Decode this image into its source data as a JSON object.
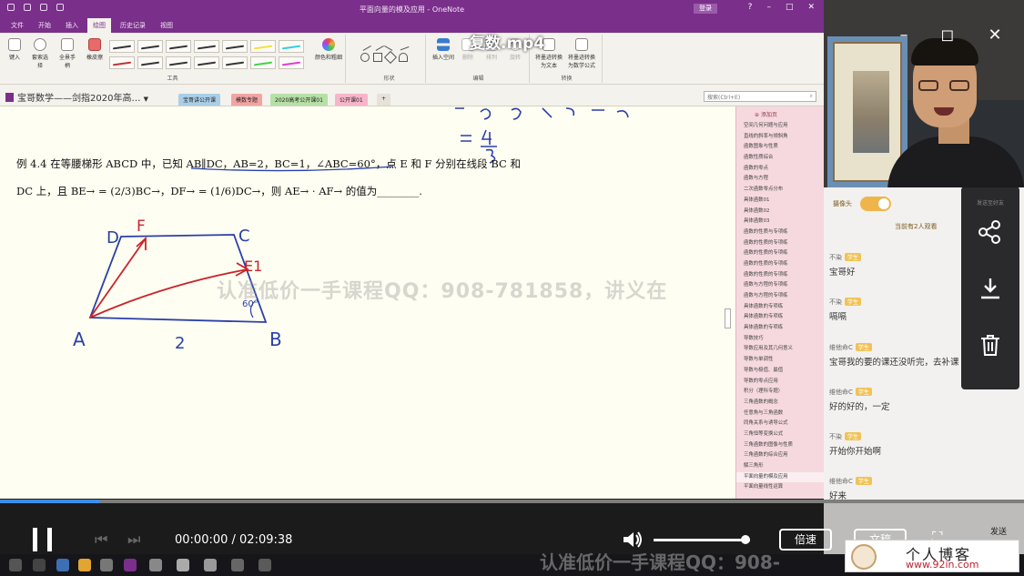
{
  "onenote": {
    "window_title": "平面向量的模及应用 - OneNote",
    "signin": "登录",
    "window_controls": [
      "?",
      "–",
      "□",
      "✕"
    ],
    "tabs": [
      "文件",
      "开始",
      "插入",
      "绘图",
      "历史记录",
      "视图"
    ],
    "active_tab": "绘图",
    "tools_group_label": "工具",
    "tools": [
      "键入",
      "套索选择",
      "全景手柄",
      "橡皮擦"
    ],
    "colors_label": "颜色和粗细",
    "shapes_label": "形状",
    "edit_label": "编辑",
    "convert_label": "转换",
    "edit_tools": [
      "插入空间",
      "删除",
      "排列",
      "旋转"
    ],
    "convert_tools": [
      "将墨迹转换为文本",
      "将墨迹转换为数学公式"
    ],
    "notebook_name": "宝哥数学——剑指2020年高…",
    "section_tabs": [
      {
        "label": "宝哥讲公开课",
        "color": "#a9cfe8"
      },
      {
        "label": "模数专题",
        "color": "#f3a3a3"
      },
      {
        "label": "2020高考公开课01",
        "color": "#b6e0a6"
      },
      {
        "label": "公开课01",
        "color": "#f7b5cb"
      }
    ],
    "add_tab": "+",
    "search_placeholder": "搜索(Ctrl+E)",
    "add_page": "添加页",
    "pages": [
      "空间几何问题与应用",
      "直线的斜率与倾斜角",
      "函数图象与性质",
      "函数性质综合",
      "函数的零点",
      "函数与方程",
      "二次函数零点分布",
      "具体函数01",
      "具体函数02",
      "具体函数03",
      "函数的性质与专项练",
      "函数的性质的专项练",
      "函数的性质的专项练",
      "函数的性质的专项练",
      "函数的性质的专项练",
      "函数与方程的专项练",
      "函数与方程的专项练",
      "具体函数的专项练",
      "具体函数的专项练",
      "具体函数的专项练",
      "导数技巧",
      "导数应用及其几何意义",
      "导数与单调性",
      "导数与极值、最值",
      "导数的零点应用",
      "积分（理科专题）",
      "三角函数的概念",
      "任意角与三角函数",
      "同角关系与诱导公式",
      "三角恒等变换公式",
      "三角函数的图像与性质",
      "三角函数的综合应用",
      "解三角形",
      "平面向量的模及应用",
      "平面向量线性运算"
    ]
  },
  "problem": {
    "line1": "例 4.4 在等腰梯形 ABCD 中，已知 AB∥DC，AB=2，BC=1，∠ABC=60°，点 E 和 F 分别在线段 BC 和",
    "line2": "DC 上，且 BE→ = (2/3)BC→，DF→ = (1/6)DC→，则 AE→ · AF→ 的值为________.",
    "handwriting_top": "= 4/3",
    "labels": {
      "D": "D",
      "F": "F",
      "C": "C",
      "E": "E1",
      "A": "A",
      "B": "B",
      "base": "2",
      "angle": "60°"
    }
  },
  "video": {
    "title": "复数.mp4",
    "time_current": "00:00:00",
    "time_total": "02:09:38",
    "time_display": "00:00:00 / 02:09:38",
    "progress_fraction": 0.097,
    "volume_fraction": 0.95,
    "speed_button": "倍速",
    "text_button": "文稿",
    "send_button": "发送"
  },
  "live": {
    "camera_label": "摄像头",
    "camera_on": true,
    "viewers": "当前有2人观看",
    "share_title": "发送至好友",
    "messages": [
      {
        "user": "不染",
        "badge": "学生",
        "text": "宝哥好"
      },
      {
        "user": "不染",
        "badge": "学生",
        "text": "嗝嗝"
      },
      {
        "user": "维他命C",
        "badge": "学生",
        "text": "宝哥我的要的课还没听完，去补课"
      },
      {
        "user": "维他命C",
        "badge": "学生",
        "text": "好的好的，一定"
      },
      {
        "user": "不染",
        "badge": "学生",
        "text": "开始你开始啊"
      },
      {
        "user": "维他命C",
        "badge": "学生",
        "text": "好来"
      }
    ]
  },
  "watermark": {
    "center": "认准低价一手课程QQ：908-781858，讲义在",
    "bottom": "认准低价一手课程QQ：908-",
    "blog_cn": "个人博客",
    "blog_url": "www.92in.com"
  }
}
